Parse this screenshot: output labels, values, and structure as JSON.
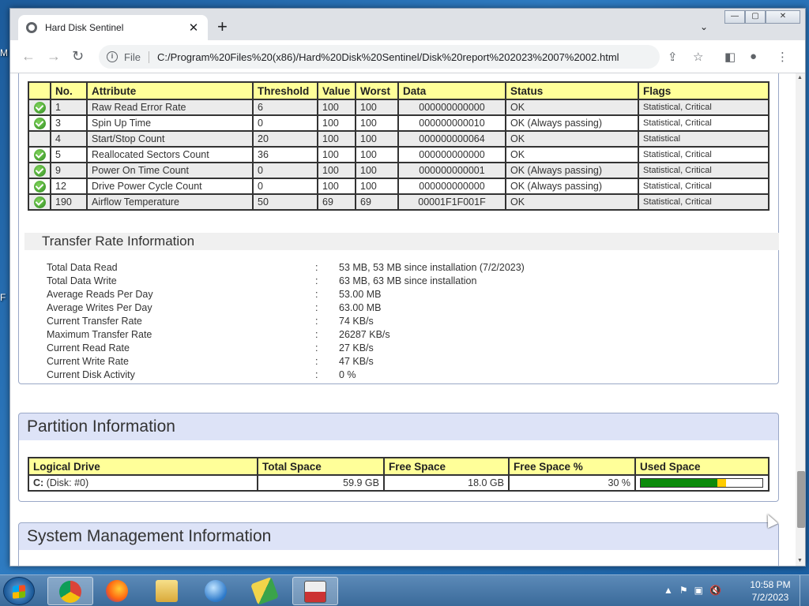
{
  "desktop": {
    "frag_top": "M",
    "frag_bottom": "F"
  },
  "browser": {
    "tab_title": "Hard Disk Sentinel",
    "tab_close": "✕",
    "new_tab": "+",
    "tab_search": "⌄",
    "window_controls": {
      "minimize": "—",
      "maximize": "▢",
      "close": "✕"
    },
    "nav": {
      "back": "←",
      "forward": "→",
      "reload": "↻"
    },
    "address_scheme": "File",
    "address_url": "C:/Program%20Files%20(x86)/Hard%20Disk%20Sentinel/Disk%20report%202023%2007%2002.html",
    "toolbar_icons": {
      "share": "⇪",
      "bookmark": "☆",
      "sidepanel": "◧",
      "profile": "●",
      "menu": "⋮"
    }
  },
  "smart": {
    "headers": [
      "",
      "No.",
      "Attribute",
      "Threshold",
      "Value",
      "Worst",
      "Data",
      "Status",
      "Flags"
    ],
    "rows": [
      {
        "icon": true,
        "no": "1",
        "attribute": "Raw Read Error Rate",
        "threshold": "6",
        "value": "100",
        "worst": "100",
        "data": "000000000000",
        "status": "OK",
        "flags": "Statistical, Critical"
      },
      {
        "icon": true,
        "no": "3",
        "attribute": "Spin Up Time",
        "threshold": "0",
        "value": "100",
        "worst": "100",
        "data": "000000000010",
        "status": "OK (Always passing)",
        "flags": "Statistical, Critical"
      },
      {
        "icon": false,
        "no": "4",
        "attribute": "Start/Stop Count",
        "threshold": "20",
        "value": "100",
        "worst": "100",
        "data": "000000000064",
        "status": "OK",
        "flags": "Statistical"
      },
      {
        "icon": true,
        "no": "5",
        "attribute": "Reallocated Sectors Count",
        "threshold": "36",
        "value": "100",
        "worst": "100",
        "data": "000000000000",
        "status": "OK",
        "flags": "Statistical, Critical"
      },
      {
        "icon": true,
        "no": "9",
        "attribute": "Power On Time Count",
        "threshold": "0",
        "value": "100",
        "worst": "100",
        "data": "000000000001",
        "status": "OK (Always passing)",
        "flags": "Statistical, Critical"
      },
      {
        "icon": true,
        "no": "12",
        "attribute": "Drive Power Cycle Count",
        "threshold": "0",
        "value": "100",
        "worst": "100",
        "data": "000000000000",
        "status": "OK (Always passing)",
        "flags": "Statistical, Critical"
      },
      {
        "icon": true,
        "no": "190",
        "attribute": "Airflow Temperature",
        "threshold": "50",
        "value": "69",
        "worst": "69",
        "data": "00001F1F001F",
        "status": "OK",
        "flags": "Statistical, Critical"
      }
    ]
  },
  "transfer": {
    "title": "Transfer Rate Information",
    "separator": ":",
    "items": [
      {
        "label": "Total Data Read",
        "value": "53 MB, 53 MB since installation (7/2/2023)"
      },
      {
        "label": "Total Data Write",
        "value": "63 MB, 63 MB since installation"
      },
      {
        "label": "Average Reads Per Day",
        "value": "53.00 MB"
      },
      {
        "label": "Average Writes Per Day",
        "value": "63.00 MB"
      },
      {
        "label": "Current Transfer Rate",
        "value": "74 KB/s"
      },
      {
        "label": "Maximum Transfer Rate",
        "value": "26287 KB/s"
      },
      {
        "label": "Current Read Rate",
        "value": "27 KB/s"
      },
      {
        "label": "Current Write Rate",
        "value": "47 KB/s"
      },
      {
        "label": "Current Disk Activity",
        "value": "0 %"
      }
    ]
  },
  "partition": {
    "title": "Partition Information",
    "headers": [
      "Logical Drive",
      "Total Space",
      "Free Space",
      "Free Space %",
      "Used Space"
    ],
    "row": {
      "drive_letter": "C:",
      "drive_desc": "(Disk: #0)",
      "total": "59.9 GB",
      "free": "18.0 GB",
      "free_pct": "30 %",
      "used_fraction": 0.7,
      "bar_colors": {
        "used": "#0b8a0b",
        "warn": "#ffcc00"
      }
    }
  },
  "system": {
    "title": "System Management Information"
  },
  "taskbar": {
    "tray_icons": [
      "▲",
      "⚑",
      "▣",
      "🔇"
    ],
    "time": "10:58 PM",
    "date": "7/2/2023"
  }
}
